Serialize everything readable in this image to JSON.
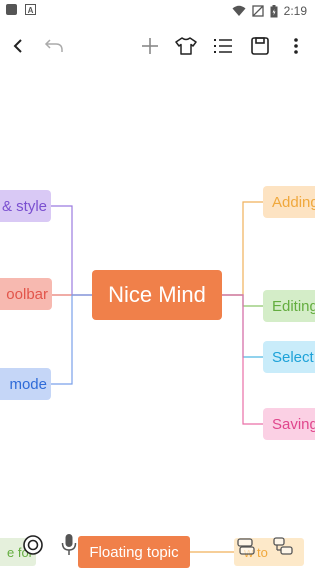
{
  "status_bar": {
    "time": "2:19",
    "icons": [
      "wifi-icon",
      "no-signal-icon",
      "battery-icon"
    ]
  },
  "toolbar": {
    "back_icon": "back-arrow-icon",
    "undo_icon": "undo-icon",
    "add_icon": "plus-icon",
    "theme_icon": "shirt-icon",
    "outline_icon": "outline-list-icon",
    "save_icon": "save-icon",
    "more_icon": "more-vertical-icon"
  },
  "mindmap": {
    "central": "Nice Mind",
    "left_nodes": [
      {
        "label": "& style",
        "bg": "#d9c9f5",
        "color": "#7a4fd0",
        "line": "#9b7be0"
      },
      {
        "label": "oolbar",
        "bg": "#f7b9b0",
        "color": "#e2554a",
        "line": "#e77a70"
      },
      {
        "label": " mode",
        "bg": "#c5d6f7",
        "color": "#2f6bd8",
        "line": "#7aa0ea"
      }
    ],
    "right_nodes": [
      {
        "label": "Adding",
        "bg": "#fde3c2",
        "color": "#f0a83c",
        "line": "#f1b15a"
      },
      {
        "label": "Editing",
        "bg": "#d4edc8",
        "color": "#64ad3f",
        "line": "#8cc56a"
      },
      {
        "label": "Select",
        "bg": "#c9ecfa",
        "color": "#1da2d8",
        "line": "#4fb8e2"
      },
      {
        "label": "Saving",
        "bg": "#fbd0e4",
        "color": "#e0468c",
        "line": "#ea6fa6"
      }
    ]
  },
  "bottom": {
    "floating_topic": "Floating topic",
    "left_fragment": "e for",
    "right_fragment": "w to",
    "target_icon": "target-icon",
    "mic_icon": "microphone-icon",
    "collapse_icon": "collapse-icon",
    "expand_icon": "expand-icon"
  }
}
